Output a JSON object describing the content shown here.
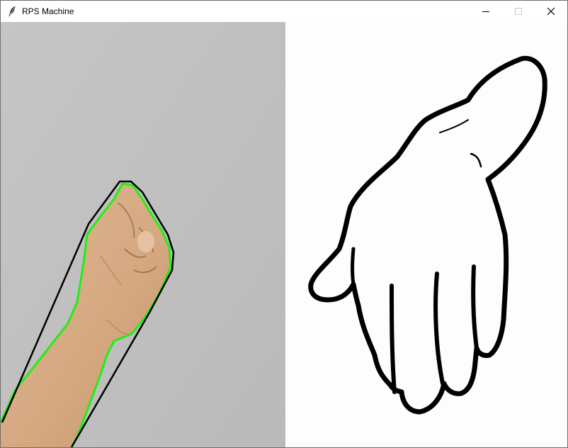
{
  "window": {
    "title": "RPS Machine",
    "icons": {
      "app": "feather-icon",
      "minimize": "minimize-icon",
      "maximize": "maximize-icon",
      "close": "close-icon"
    }
  },
  "colors": {
    "camera_background": "#bebfbe",
    "skin": "#d7ac86",
    "contour": "#22ee11",
    "hull": "#000000",
    "drawing_background": "#fdfdfd"
  }
}
